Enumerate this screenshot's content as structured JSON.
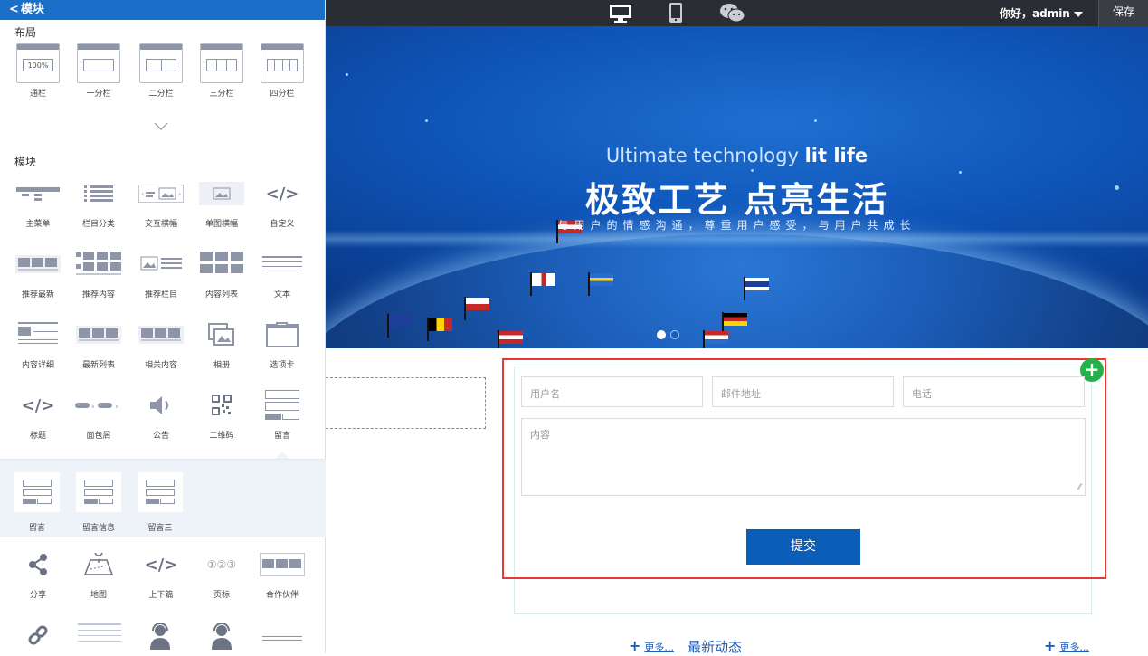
{
  "panel": {
    "back_label": "模块",
    "close_label": "×",
    "layout_title": "布局",
    "layout_items": [
      {
        "label": "通栏",
        "tag": "100%"
      },
      {
        "label": "一分栏"
      },
      {
        "label": "二分栏"
      },
      {
        "label": "三分栏"
      },
      {
        "label": "四分栏"
      }
    ],
    "module_title": "模块",
    "modules": [
      {
        "label": "主菜单",
        "icon": "menu-icon"
      },
      {
        "label": "栏目分类",
        "icon": "list-icon"
      },
      {
        "label": "交互横幅",
        "icon": "carousel-icon"
      },
      {
        "label": "单图横幅",
        "icon": "image-banner-icon"
      },
      {
        "label": "自定义",
        "icon": "code-icon"
      },
      {
        "label": "推荐最新",
        "icon": "image-grid-icon"
      },
      {
        "label": "推荐内容",
        "icon": "image-list-icon"
      },
      {
        "label": "推荐栏目",
        "icon": "image-text-icon"
      },
      {
        "label": "内容列表",
        "icon": "content-list-icon"
      },
      {
        "label": "文本",
        "icon": "text-icon"
      },
      {
        "label": "内容详细",
        "icon": "content-detail-icon"
      },
      {
        "label": "最新列表",
        "icon": "latest-list-icon"
      },
      {
        "label": "相关内容",
        "icon": "related-content-icon"
      },
      {
        "label": "相册",
        "icon": "album-icon"
      },
      {
        "label": "选项卡",
        "icon": "tabs-icon"
      },
      {
        "label": "标题",
        "icon": "title-code-icon"
      },
      {
        "label": "面包屑",
        "icon": "breadcrumb-icon"
      },
      {
        "label": "公告",
        "icon": "speaker-icon"
      },
      {
        "label": "二维码",
        "icon": "qrcode-icon"
      },
      {
        "label": "留言",
        "icon": "message-form-icon"
      }
    ],
    "sub_modules": [
      {
        "label": "留言"
      },
      {
        "label": "留言信息"
      },
      {
        "label": "留言三"
      }
    ],
    "more_modules": [
      {
        "label": "分享",
        "icon": "share-icon"
      },
      {
        "label": "地图",
        "icon": "map-icon"
      },
      {
        "label": "上下篇",
        "icon": "prev-next-icon"
      },
      {
        "label": "页标",
        "icon": "pagination-icon",
        "digits": "①②③"
      },
      {
        "label": "合作伙伴",
        "icon": "partners-icon"
      }
    ]
  },
  "toolbar": {
    "greeting": "你好，admin",
    "save_label": "保存",
    "devices": [
      "desktop-icon",
      "mobile-icon",
      "wechat-icon"
    ]
  },
  "hero": {
    "en_prefix": "Ultimate technology ",
    "en_bold": "lit life",
    "title": "极致工艺 点亮生活",
    "subtitle": "与用户的情感沟通，尊重用户感受，与用户共成长"
  },
  "form": {
    "username_placeholder": "用户名",
    "email_placeholder": "邮件地址",
    "phone_placeholder": "电话",
    "content_placeholder": "内容",
    "submit_label": "提交"
  },
  "footer": {
    "more_label": "更多...",
    "news_title": "最新动态"
  },
  "colors": {
    "panel_header": "#1c6fc8",
    "toolbar": "#2a2d33",
    "selection": "#e53935",
    "add_button": "#26b04a",
    "submit": "#0b5eb8"
  }
}
